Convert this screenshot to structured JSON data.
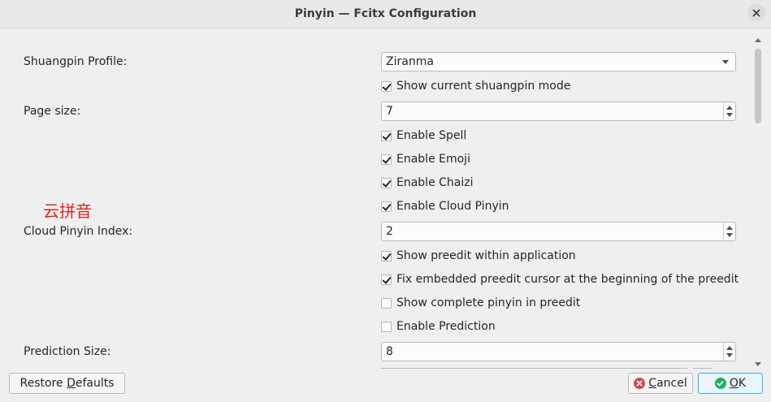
{
  "window": {
    "title": "Pinyin — Fcitx Configuration"
  },
  "settings": {
    "shuangpin_profile": {
      "label": "Shuangpin Profile:",
      "value": "Ziranma"
    },
    "show_shuangpin_mode": {
      "label": "Show current shuangpin mode",
      "checked": true
    },
    "page_size": {
      "label": "Page size:",
      "value": "7"
    },
    "enable_spell": {
      "label": "Enable Spell",
      "checked": true
    },
    "enable_emoji": {
      "label": "Enable Emoji",
      "checked": true
    },
    "enable_chaizi": {
      "label": "Enable Chaizi",
      "checked": true
    },
    "enable_cloud_pinyin": {
      "label": "Enable Cloud Pinyin",
      "checked": true
    },
    "cloud_pinyin_index": {
      "label": "Cloud Pinyin Index:",
      "value": "2"
    },
    "show_preedit": {
      "label": "Show preedit within application",
      "checked": true
    },
    "fix_embedded_cursor": {
      "label": "Fix embedded preedit cursor at the beginning of the preedit",
      "checked": true
    },
    "show_complete_pinyin": {
      "label": "Show complete pinyin in preedit",
      "checked": false
    },
    "enable_prediction": {
      "label": "Enable Prediction",
      "checked": false
    },
    "prediction_size": {
      "label": "Prediction Size:",
      "value": "8"
    }
  },
  "annotation": {
    "text": "云拼音",
    "color": "#e8231a"
  },
  "footer": {
    "restore_pre": "Restore ",
    "restore_mn": "D",
    "restore_post": "efaults",
    "cancel_mn": "C",
    "cancel_post": "ancel",
    "ok_mn": "O",
    "ok_post": "K"
  },
  "colors": {
    "accent": "#3daee9",
    "cancel_icon": "#da4453",
    "ok_icon": "#27ae60"
  },
  "icons": {
    "close": "close-icon",
    "cancel": "cancel-icon",
    "ok": "ok-icon"
  }
}
